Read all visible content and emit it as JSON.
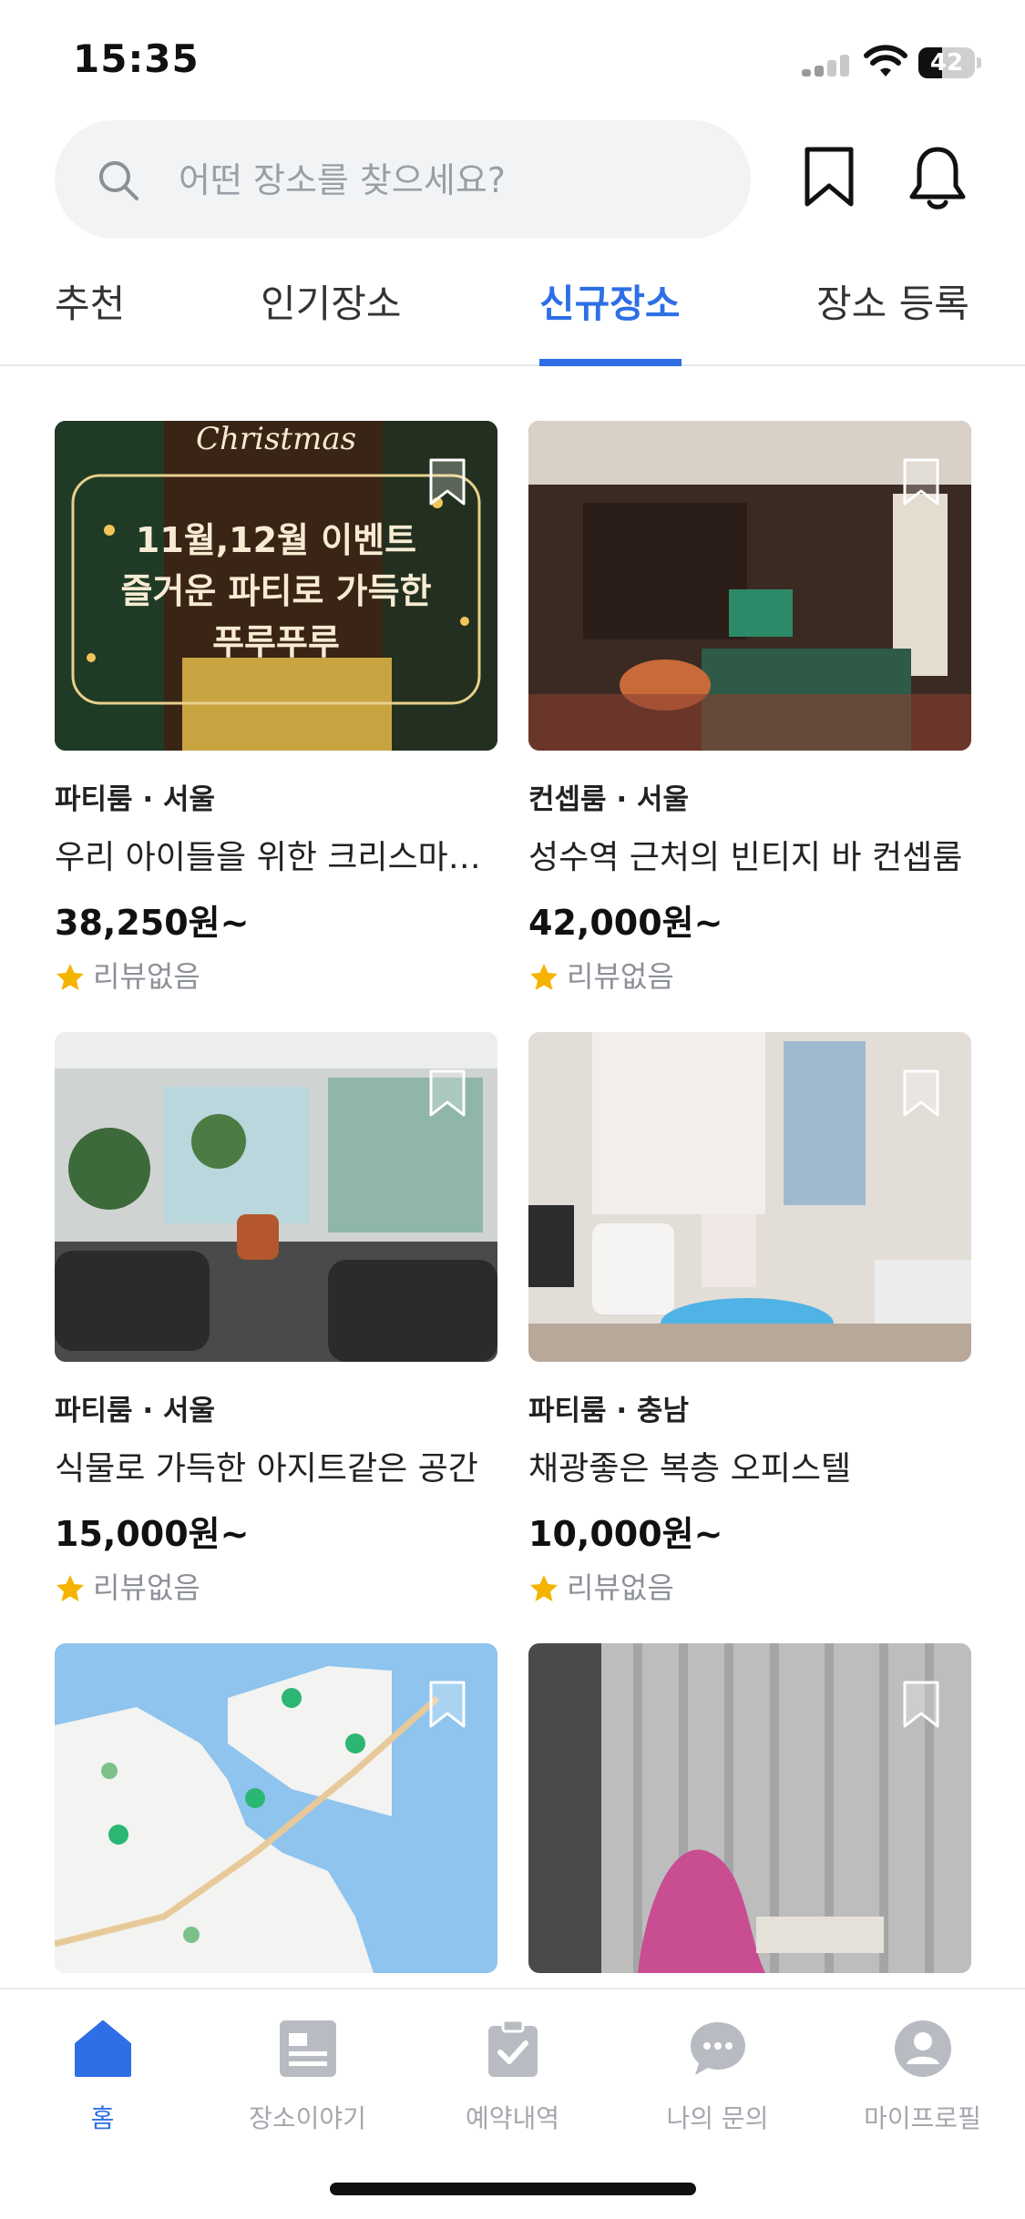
{
  "status_bar": {
    "time": "15:35",
    "battery": "42",
    "battery_level": 0.42
  },
  "search": {
    "placeholder": "어떤 장소를 찾으세요?"
  },
  "tabs": [
    {
      "label": "추천",
      "active": false
    },
    {
      "label": "인기장소",
      "active": false
    },
    {
      "label": "신규장소",
      "active": true
    },
    {
      "label": "장소 등록",
      "active": false
    }
  ],
  "cards": [
    {
      "meta": "파티룸 · 서울",
      "title": "우리 아이들을 위한 크리스마스 파티룸",
      "price": "38,250원~",
      "review": "리뷰없음",
      "image_text": {
        "script": "Christmas",
        "line1": "11월,12월 이벤트",
        "line2": "즐거운 파티로 가득한",
        "line3": "푸루푸루"
      }
    },
    {
      "meta": "컨셉룸 · 서울",
      "title": "성수역 근처의 빈티지 바 컨셉룸",
      "price": "42,000원~",
      "review": "리뷰없음"
    },
    {
      "meta": "파티룸 · 서울",
      "title": "식물로 가득한 아지트같은 공간",
      "price": "15,000원~",
      "review": "리뷰없음"
    },
    {
      "meta": "파티룸 · 충남",
      "title": "채광좋은 복층 오피스텔",
      "price": "10,000원~",
      "review": "리뷰없음"
    },
    {
      "meta": "",
      "title": "",
      "price": "",
      "review": ""
    },
    {
      "meta": "",
      "title": "",
      "price": "",
      "review": ""
    }
  ],
  "bottom_nav": [
    {
      "label": "홈",
      "icon": "home-icon",
      "active": true
    },
    {
      "label": "장소이야기",
      "icon": "story-icon",
      "active": false
    },
    {
      "label": "예약내역",
      "icon": "reservation-icon",
      "active": false
    },
    {
      "label": "나의 문의",
      "icon": "chat-icon",
      "active": false
    },
    {
      "label": "마이프로필",
      "icon": "profile-icon",
      "active": false
    }
  ],
  "colors": {
    "accent": "#2e6fe6",
    "star": "#f5b400",
    "muted": "#a3a7ad"
  }
}
